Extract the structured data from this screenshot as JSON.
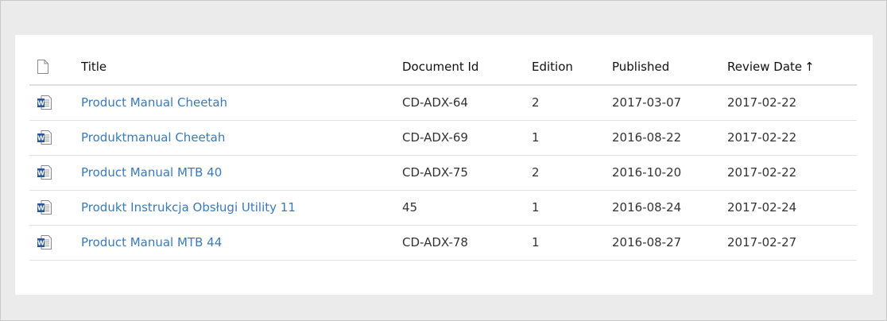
{
  "table": {
    "columns": {
      "icon": "file-icon",
      "title": "Title",
      "document_id": "Document Id",
      "edition": "Edition",
      "published": "Published",
      "review_date": "Review Date",
      "review_sort_glyph": "↑"
    },
    "rows": [
      {
        "icon": "word-document-icon",
        "title": "Product Manual Cheetah",
        "document_id": "CD-ADX-64",
        "edition": "2",
        "published": "2017-03-07",
        "review_date": "2017-02-22"
      },
      {
        "icon": "word-document-icon",
        "title": "Produktmanual Cheetah",
        "document_id": "CD-ADX-69",
        "edition": "1",
        "published": "2016-08-22",
        "review_date": "2017-02-22"
      },
      {
        "icon": "word-document-icon",
        "title": "Product Manual MTB 40",
        "document_id": "CD-ADX-75",
        "edition": "2",
        "published": "2016-10-20",
        "review_date": "2017-02-22"
      },
      {
        "icon": "word-document-icon",
        "title": "Produkt Instrukcja Obsługi Utility 11",
        "document_id": "45",
        "edition": "1",
        "published": "2016-08-24",
        "review_date": "2017-02-24"
      },
      {
        "icon": "word-document-icon",
        "title": "Product Manual MTB 44",
        "document_id": "CD-ADX-78",
        "edition": "1",
        "published": "2016-08-27",
        "review_date": "2017-02-27"
      }
    ]
  },
  "colors": {
    "link": "#3a7ab8",
    "word_blue": "#2b5797",
    "background": "#ebebeb",
    "panel": "#ffffff"
  }
}
